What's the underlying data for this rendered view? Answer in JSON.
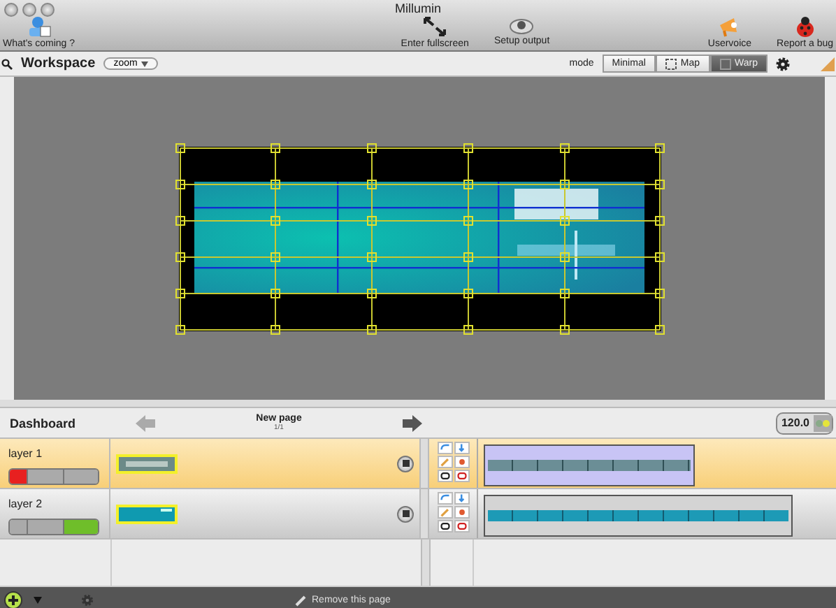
{
  "window": {
    "title": "Millumin"
  },
  "toolbar": {
    "left": [
      {
        "kind": "info",
        "label": "What's coming ?"
      }
    ],
    "center": [
      {
        "kind": "fullscreen",
        "label": "Enter fullscreen"
      },
      {
        "kind": "output",
        "label": "Setup output"
      }
    ],
    "right": [
      {
        "kind": "megaphone",
        "label": "Uservoice"
      },
      {
        "kind": "bug",
        "label": "Report a bug"
      }
    ]
  },
  "workspace": {
    "title": "Workspace",
    "zoom": "zoom",
    "mode_label": "mode",
    "modes": [
      {
        "label": "Minimal",
        "kind": "plain",
        "selected": false
      },
      {
        "label": "Map",
        "kind": "map",
        "selected": false
      },
      {
        "label": "Warp",
        "kind": "warp",
        "selected": true
      }
    ]
  },
  "dashboard": {
    "title": "Dashboard",
    "page_title": "New page",
    "page_count": "1/1",
    "tempo": "120.0"
  },
  "layers": [
    {
      "name": "layer 1",
      "selected": true,
      "color": "#e82020",
      "segments": [
        {
          "on": true
        },
        {
          "on": false
        },
        {
          "on": false
        }
      ],
      "clip_selected": true
    },
    {
      "name": "layer 2",
      "selected": false,
      "color": "#6fbe2a",
      "segments": [
        {
          "on": false
        },
        {
          "on": false
        },
        {
          "on": true
        }
      ],
      "clip_selected": false
    }
  ],
  "bottom_bar": {
    "remove_label": "Remove this page"
  }
}
